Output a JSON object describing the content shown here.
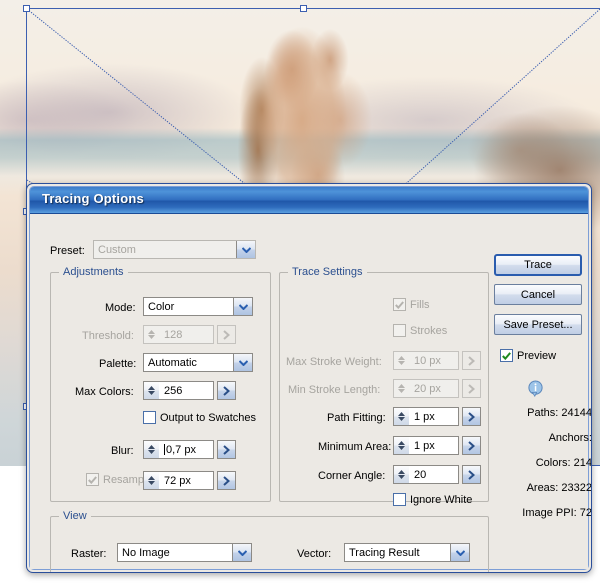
{
  "dialog": {
    "title": "Tracing Options",
    "preset": {
      "label": "Preset:",
      "value": "Custom"
    },
    "adjustments": {
      "legend": "Adjustments",
      "mode": {
        "label": "Mode:",
        "value": "Color"
      },
      "threshold": {
        "label": "Threshold:",
        "value": "128",
        "enabled": false
      },
      "palette": {
        "label": "Palette:",
        "value": "Automatic"
      },
      "max_colors": {
        "label": "Max Colors:",
        "value": "256"
      },
      "output_to_swatches": {
        "label": "Output to Swatches",
        "checked": false
      },
      "blur": {
        "label": "Blur:",
        "value": "0,7 px"
      },
      "resample": {
        "label": "Resample:",
        "value": "72 px",
        "checked": true,
        "enabled": false
      }
    },
    "trace_settings": {
      "legend": "Trace Settings",
      "fills": {
        "label": "Fills",
        "checked": true,
        "enabled": false
      },
      "strokes": {
        "label": "Strokes",
        "checked": false,
        "enabled": false
      },
      "max_stroke_weight": {
        "label": "Max Stroke Weight:",
        "value": "10 px",
        "enabled": false
      },
      "min_stroke_length": {
        "label": "Min Stroke Length:",
        "value": "20 px",
        "enabled": false
      },
      "path_fitting": {
        "label": "Path Fitting:",
        "value": "1 px"
      },
      "minimum_area": {
        "label": "Minimum Area:",
        "value": "1 px"
      },
      "corner_angle": {
        "label": "Corner Angle:",
        "value": "20"
      },
      "ignore_white": {
        "label": "Ignore White",
        "checked": false
      }
    },
    "view": {
      "legend": "View",
      "raster": {
        "label": "Raster:",
        "value": "No Image"
      },
      "vector": {
        "label": "Vector:",
        "value": "Tracing Result"
      }
    },
    "actions": {
      "trace": "Trace",
      "cancel": "Cancel",
      "save_preset": "Save Preset...",
      "preview": {
        "label": "Preview",
        "checked": true
      }
    },
    "stats": {
      "paths": "Paths: 24144",
      "anchors": "Anchors:",
      "colors": "Colors: 214",
      "areas": "Areas: 23322",
      "image_ppi": "Image PPI: 72"
    }
  },
  "colors": {
    "title_blue": "#2e6bbd",
    "dialog_face": "#ece9e4",
    "legend_text": "#2b4f8f",
    "selection_blue": "#3c5fb0",
    "check_green": "#1f8a1f"
  }
}
